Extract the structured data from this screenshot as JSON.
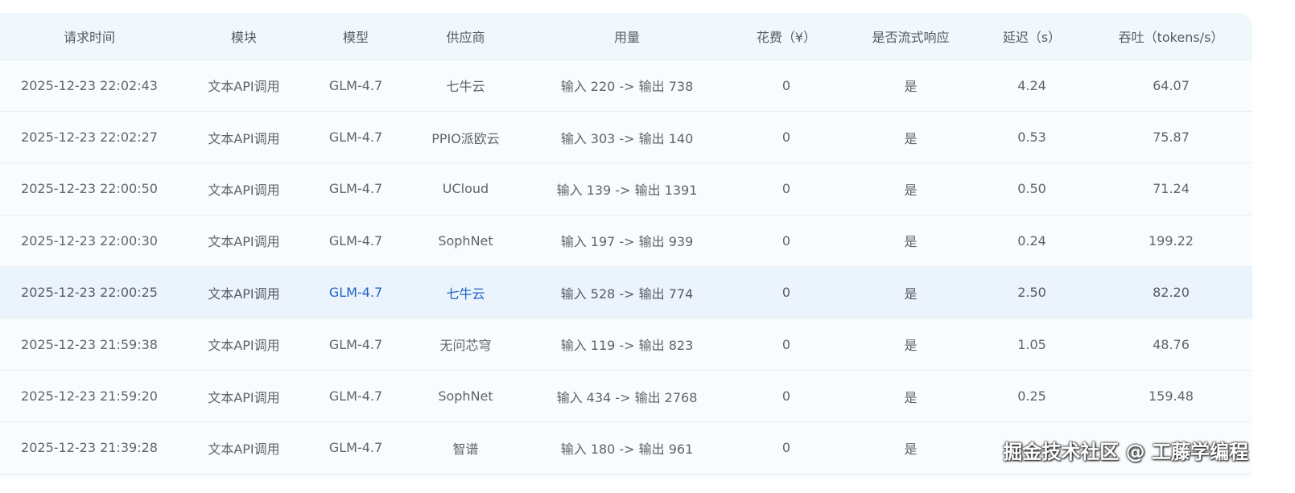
{
  "headers": [
    "请求时间",
    "模块",
    "模型",
    "供应商",
    "用量",
    "花费（¥）",
    "是否流式响应",
    "延迟（s）",
    "吞吐（tokens/s）"
  ],
  "rows": [
    {
      "time": "2025-12-23 22:02:43",
      "module": "文本API调用",
      "model": "GLM-4.7",
      "provider": "七牛云",
      "usage": "输入 220 -> 输出 738",
      "cost": "0",
      "stream": "是",
      "latency": "4.24",
      "throughput": "64.07"
    },
    {
      "time": "2025-12-23 22:02:27",
      "module": "文本API调用",
      "model": "GLM-4.7",
      "provider": "PPIO派欧云",
      "usage": "输入 303 -> 输出 140",
      "cost": "0",
      "stream": "是",
      "latency": "0.53",
      "throughput": "75.87"
    },
    {
      "time": "2025-12-23 22:00:50",
      "module": "文本API调用",
      "model": "GLM-4.7",
      "provider": "UCloud",
      "usage": "输入 139 -> 输出 1391",
      "cost": "0",
      "stream": "是",
      "latency": "0.50",
      "throughput": "71.24"
    },
    {
      "time": "2025-12-23 22:00:30",
      "module": "文本API调用",
      "model": "GLM-4.7",
      "provider": "SophNet",
      "usage": "输入 197 -> 输出 939",
      "cost": "0",
      "stream": "是",
      "latency": "0.24",
      "throughput": "199.22"
    },
    {
      "time": "2025-12-23 22:00:25",
      "module": "文本API调用",
      "model": "GLM-4.7",
      "provider": "七牛云",
      "usage": "输入 528 -> 输出 774",
      "cost": "0",
      "stream": "是",
      "latency": "2.50",
      "throughput": "82.20"
    },
    {
      "time": "2025-12-23 21:59:38",
      "module": "文本API调用",
      "model": "GLM-4.7",
      "provider": "无问芯穹",
      "usage": "输入 119 -> 输出 823",
      "cost": "0",
      "stream": "是",
      "latency": "1.05",
      "throughput": "48.76"
    },
    {
      "time": "2025-12-23 21:59:20",
      "module": "文本API调用",
      "model": "GLM-4.7",
      "provider": "SophNet",
      "usage": "输入 434 -> 输出 2768",
      "cost": "0",
      "stream": "是",
      "latency": "0.25",
      "throughput": "159.48"
    },
    {
      "time": "2025-12-23 21:39:28",
      "module": "文本API调用",
      "model": "GLM-4.7",
      "provider": "智谱",
      "usage": "输入 180 -> 输出 961",
      "cost": "0",
      "stream": "是",
      "latency": "",
      "throughput": ""
    }
  ],
  "watermark": "掘金技术社区 @ 工藤学编程",
  "colors": {
    "header_bg": "#f1f8fc",
    "row_bg": "#f9fcfe",
    "highlight_bg": "#ebf3fd",
    "link": "#1f63c6"
  }
}
